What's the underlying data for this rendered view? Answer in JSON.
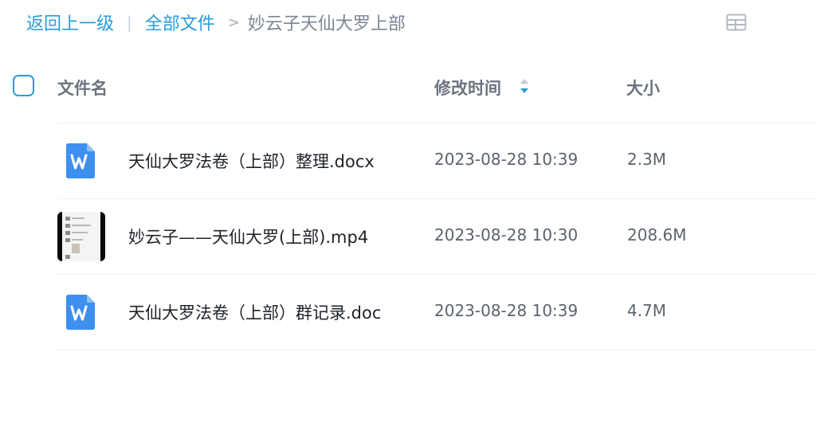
{
  "breadcrumb": {
    "back": "返回上一级",
    "separator": "|",
    "root": "全部文件",
    "arrow": ">",
    "current": "妙云子天仙大罗上部"
  },
  "toolbar": {
    "view_toggle_icon": "grid-view-icon"
  },
  "table": {
    "columns": {
      "name": "文件名",
      "modified": "修改时间",
      "size": "大小"
    },
    "sort_icon": "sort-arrows-icon",
    "accent_color": "#2b9bd8",
    "rows": [
      {
        "name": "天仙大罗法卷（上部）整理.docx",
        "modified": "2023-08-28 10:39",
        "size": "2.3M",
        "icon": "word-doc-icon"
      },
      {
        "name": "妙云子——天仙大罗(上部).mp4",
        "modified": "2023-08-28 10:30",
        "size": "208.6M",
        "icon": "video-thumbnail"
      },
      {
        "name": "天仙大罗法卷（上部）群记录.doc",
        "modified": "2023-08-28 10:39",
        "size": "4.7M",
        "icon": "word-doc-icon"
      }
    ]
  }
}
